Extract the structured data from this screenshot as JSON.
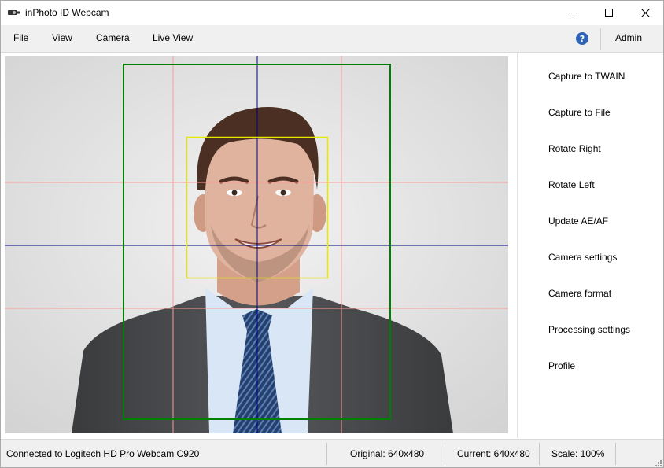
{
  "window": {
    "title": "inPhoto ID Webcam"
  },
  "menu": {
    "items": [
      "File",
      "View",
      "Camera",
      "Live View"
    ],
    "help": "?",
    "admin": "Admin"
  },
  "actions": [
    "Capture to TWAIN",
    "Capture to File",
    "Rotate Right",
    "Rotate Left",
    "Update AE/AF",
    "Camera settings",
    "Camera format",
    "Processing settings",
    "Profile"
  ],
  "status": {
    "connection": "Connected to Logitech HD Pro Webcam C920",
    "original": "Original: 640x480",
    "current": "Current: 640x480",
    "scale": "Scale: 100%"
  },
  "colors": {
    "face_frame": "#008000",
    "head_box": "#e8e800",
    "guide_lines": "#ff9a9a",
    "center_lines": "#000080",
    "help_badge": "#2f64b4"
  },
  "icons": {
    "app": "webcam-icon",
    "minimize": "minimize-icon",
    "maximize": "maximize-icon",
    "close": "close-icon",
    "help": "help-icon",
    "grip": "resize-grip-icon"
  }
}
